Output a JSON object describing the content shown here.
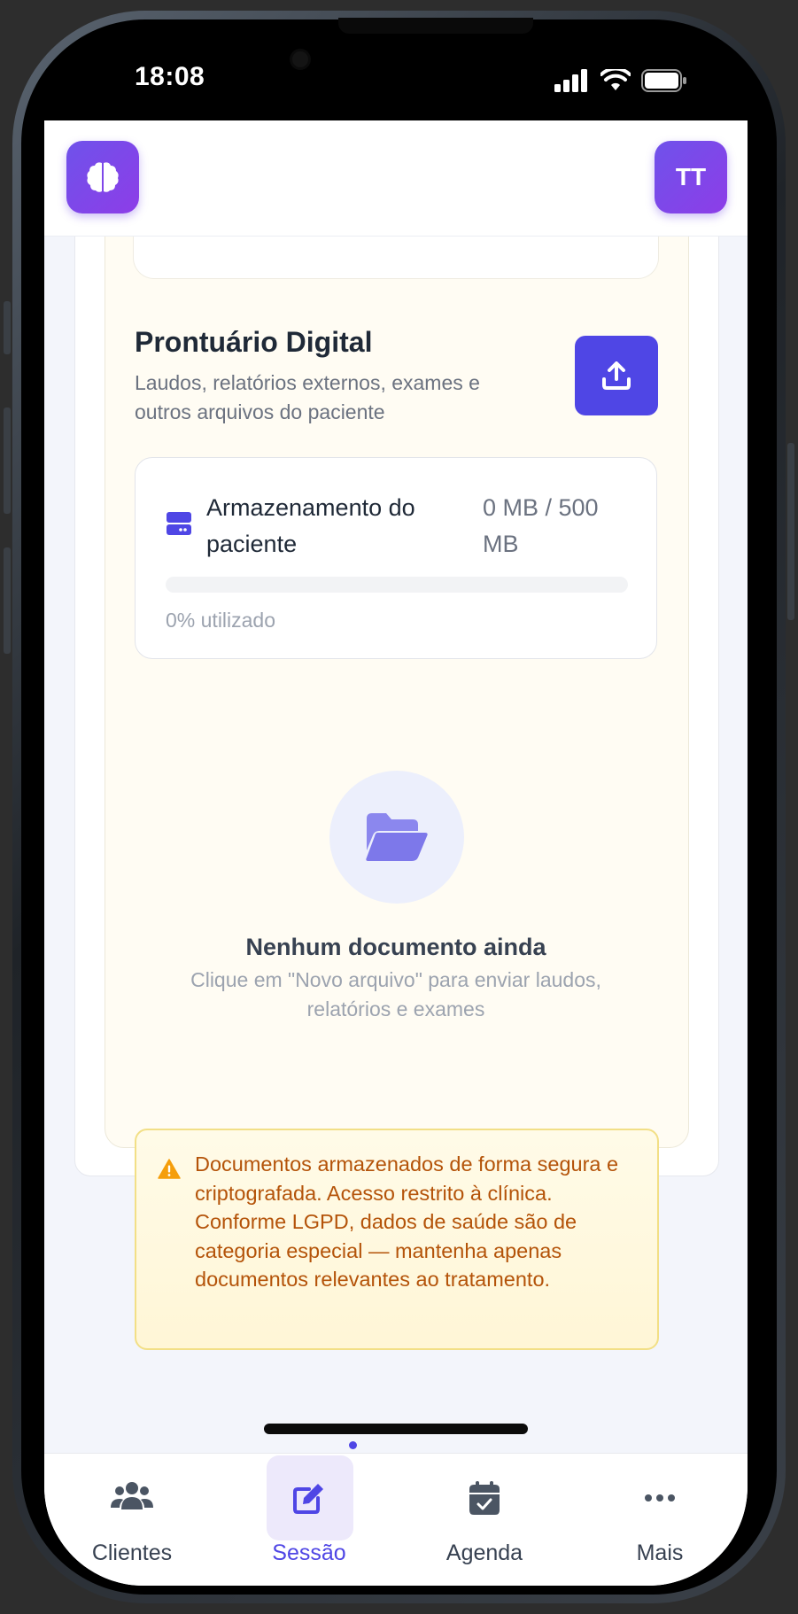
{
  "status_bar": {
    "time": "18:08"
  },
  "header": {
    "avatar_initials": "TT"
  },
  "section": {
    "title": "Prontuário Digital",
    "description": "Laudos, relatórios externos, exames e outros arquivos do paciente"
  },
  "storage": {
    "label": "Armazenamento do paciente",
    "value": "0 MB / 500 MB",
    "usage_text": "0% utilizado",
    "used_fraction": 0
  },
  "empty_state": {
    "title": "Nenhum documento ainda",
    "description": "Clique em \"Novo arquivo\" para enviar laudos, relatórios e exames"
  },
  "warning": {
    "text": "Documentos armazenados de forma segura e criptografada. Acesso restrito à clínica. Conforme LGPD, dados de saúde são de categoria especial — mantenha apenas documentos relevantes ao tratamento."
  },
  "bottom_nav": {
    "items": [
      {
        "label": "Clientes",
        "icon": "users-icon"
      },
      {
        "label": "Sessão",
        "icon": "edit-icon",
        "active": true
      },
      {
        "label": "Agenda",
        "icon": "calendar-check-icon"
      },
      {
        "label": "Mais",
        "icon": "more-dots-icon"
      }
    ]
  },
  "colors": {
    "primary": "#4f46e5",
    "brand_gradient_start": "#6f52ea",
    "brand_gradient_end": "#8d3de8",
    "warning_text": "#b45309",
    "warning_border": "#f2df86"
  }
}
